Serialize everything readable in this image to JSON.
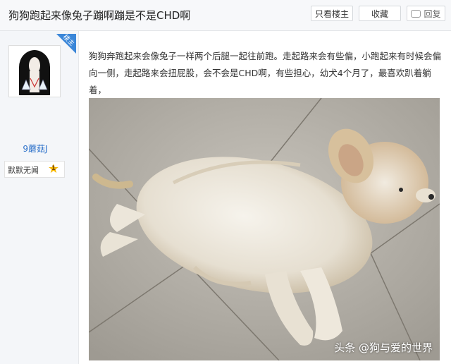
{
  "header": {
    "title": "狗狗跑起来像兔子蹦啊蹦是不是CHD啊",
    "only_owner_label": "只看楼主",
    "favorite_label": "收藏",
    "reply_label": "回复"
  },
  "sidebar": {
    "badge_label": "楼主",
    "username": "9蘑菇J",
    "level_title": "默默无闻",
    "level_number": "1"
  },
  "post": {
    "content": "狗狗奔跑起来会像兔子一样两个后腿一起往前跑。走起路来会有些偏，小跑起来有时候会偏向一侧，走起路来会扭屁股，会不会是CHD啊，有些担心，幼犬4个月了，最喜欢趴着躺着，"
  },
  "photo": {
    "watermark": "头条 @狗与爱的世界"
  },
  "colors": {
    "accent": "#3a86d8",
    "link": "#2a6fc9",
    "star": "#f4b400"
  }
}
